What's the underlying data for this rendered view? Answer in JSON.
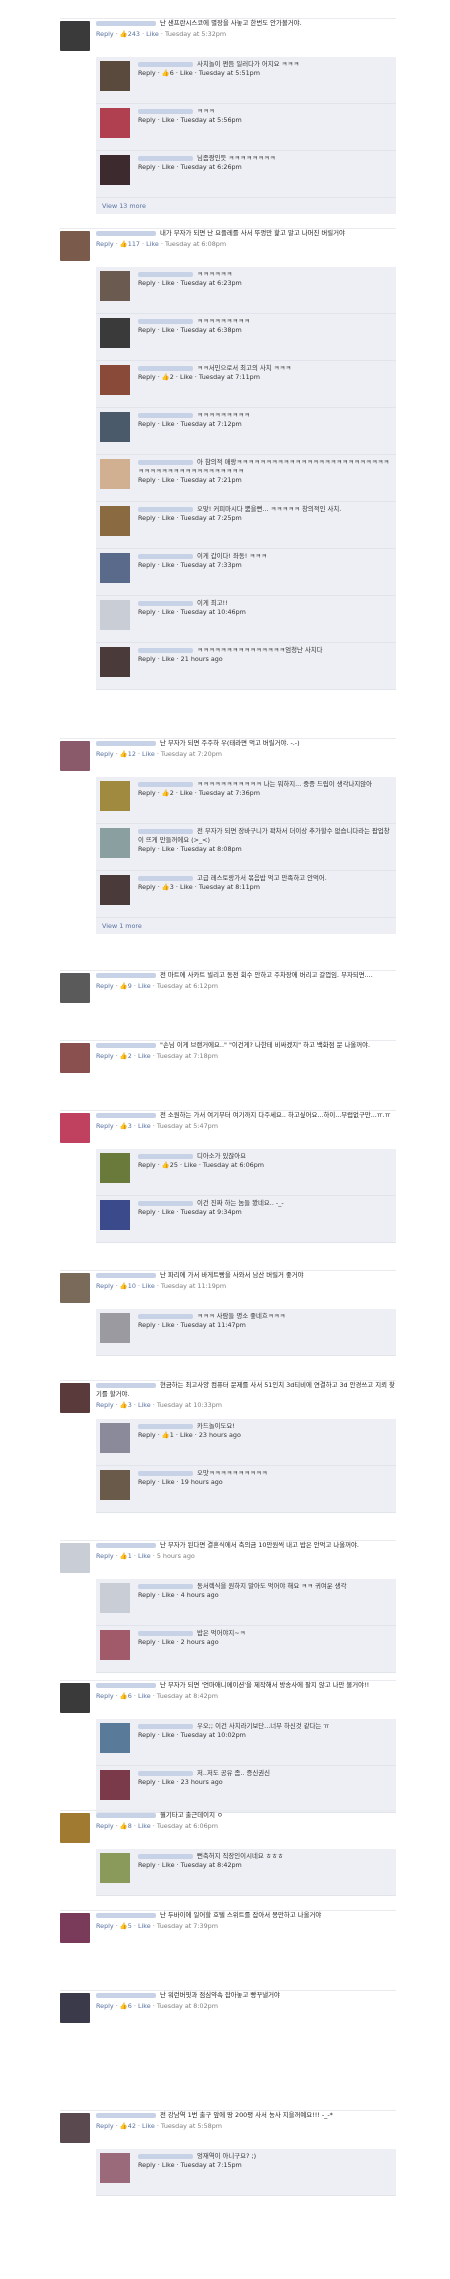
{
  "threads": [
    {
      "comment": {
        "text": "난 샌프란시스코에 별장을 사놓고 한번도 안가볼거야.",
        "likes": "243",
        "like": "Like",
        "reply": "Reply",
        "time": "Tuesday at 5:32pm",
        "color": "#3a3a3a"
      },
      "replies": [
        {
          "text": "사치놀이 쩐듬 일러다가 어지요 ㅋㅋㅋ",
          "likes": "6",
          "time": "Tuesday at 5:51pm",
          "color": "#5a4a3e"
        },
        {
          "text": "ㅋㅋㅋ",
          "likes": "",
          "time": "Tuesday at 5:56pm",
          "color": "#b04050"
        },
        {
          "text": "님좀짱인듯 ㅋㅋㅋㅋㅋㅋㅋㅋ",
          "likes": "",
          "time": "Tuesday at 6:26pm",
          "color": "#3c2a2e"
        }
      ],
      "view_more": "View 13 more"
    },
    {
      "comment": {
        "text": "내가 부자가 되면 난 요플레를 사서 뚜껑만 핥고 말고 나머진 버릴거야",
        "likes": "117",
        "like": "Like",
        "reply": "Reply",
        "time": "Tuesday at 6:08pm",
        "color": "#7a5a4a"
      },
      "replies": [
        {
          "text": "ㅋㅋㅋㅋㅋㅋ",
          "likes": "",
          "time": "Tuesday at 6:23pm",
          "color": "#6a5a50"
        },
        {
          "text": "ㅋㅋㅋㅋㅋㅋㅋㅋㅋ",
          "likes": "",
          "time": "Tuesday at 6:38pm",
          "color": "#3a3a3a"
        },
        {
          "text": "ㅋㅋ서민으로서 최고의 사치 ㅋㅋㅋ",
          "likes": "2",
          "time": "Tuesday at 7:11pm",
          "color": "#8a4a3a"
        },
        {
          "text": "ㅋㅋㅋㅋㅋㅋㅋㅋㅋ",
          "likes": "",
          "time": "Tuesday at 7:12pm",
          "color": "#4a5a6a"
        },
        {
          "text": "아 참의적 매랑ㅋㅋㅋㅋㅋㅋㅋㅋㅋㅋㅋㅋㅋㅋㅋㅋㅋㅋㅋㅋㅋㅋㅋㅋㅋㅋㅋㅋㅋㅋㅋㅋㅋㅋㅋㅋㅋㅋㅋㅋㅋㅋㅋㅋ",
          "likes": "",
          "time": "Tuesday at 7:21pm",
          "color": "#d0b090"
        },
        {
          "text": "오맞! 커피마시다 뿜을뻔... ㅋㅋㅋㅋㅋ 창의적인 사치.",
          "likes": "",
          "time": "Tuesday at 7:25pm",
          "color": "#8a6a40"
        },
        {
          "text": "이게 갑이다! 좌동! ㅋㅋㅋ",
          "likes": "",
          "time": "Tuesday at 7:33pm",
          "color": "#5a6a8a"
        },
        {
          "text": "이게 최고!!",
          "likes": "",
          "time": "Tuesday at 10:46pm",
          "color": "#c8cdd6"
        },
        {
          "text": "ㅋㅋㅋㅋㅋㅋㅋㅋㅋㅋㅋㅋㅋㅋㅋ엄청난 사치다",
          "likes": "",
          "time": "21 hours ago",
          "color": "#4a3a3a"
        }
      ]
    },
    {
      "comment": {
        "text": "난 부자가 되면 주주하 우(태라면 먹고 버릴거야. -.-)",
        "likes": "12",
        "like": "Like",
        "reply": "Reply",
        "time": "Tuesday at 7:20pm",
        "color": "#8a5a6a"
      },
      "replies": [
        {
          "text": "ㅋㅋㅋㅋㅋㅋㅋㅋㅋㅋㅋ 나는 뭐하지... 중증 드립이 생각나지않아",
          "likes": "2",
          "time": "Tuesday at 7:36pm",
          "color": "#a08a40"
        },
        {
          "text": "전 부자가 되면 장바구니가 꽉차서 더이상 추가할수 없습니다라는 팝업창이 뜨게 만들꺼에요 (>_<)",
          "likes": "",
          "time": "Tuesday at 8:08pm",
          "color": "#8aa0a0"
        },
        {
          "text": "고급 레스토랑가서 볶음밥 먹고 만족하고 안먹어.",
          "likes": "3",
          "time": "Tuesday at 8:11pm",
          "color": "#4a3a3a"
        }
      ],
      "view_more": "View 1 more"
    },
    {
      "comment": {
        "text": "전 마트에 사카트 빌리고 동전 회수 안하고 주차장에 버리고 갈껍임. 부자되면....",
        "likes": "9",
        "like": "Like",
        "reply": "Reply",
        "time": "Tuesday at 6:12pm",
        "color": "#5a5a5a"
      },
      "replies": []
    },
    {
      "comment": {
        "text": "\"손님 이게 브랜거에요..\" \"이건게? 나한테 비싸겠지\" 하고 백화점 문 나올꺼야.",
        "likes": "2",
        "like": "Like",
        "reply": "Reply",
        "time": "Tuesday at 7:18pm",
        "color": "#8a5050"
      },
      "replies": []
    },
    {
      "comment": {
        "text": "전 소원하는 가서 여기부터 여기까지 다주세요.. 하고싶어요...하이...부럽없구만...ㅠ.ㅠ",
        "likes": "3",
        "like": "Like",
        "reply": "Reply",
        "time": "Tuesday at 5:47pm",
        "color": "#c04060"
      },
      "replies": [
        {
          "text": "디아소가 있잖아요",
          "likes": "25",
          "time": "Tuesday at 6:06pm",
          "color": "#6a7a3a"
        },
        {
          "text": "이건 진짜 하는 놈들 봤네요.. -_-",
          "likes": "",
          "time": "Tuesday at 9:34pm",
          "color": "#3a4a8a"
        }
      ]
    },
    {
      "comment": {
        "text": "난 파리에 가서 바게트빵을 사와서 남산 버릴거 좋거야",
        "likes": "10",
        "like": "Like",
        "reply": "Reply",
        "time": "Tuesday at 11:19pm",
        "color": "#7a6a5a"
      },
      "replies": [
        {
          "text": "ㅋㅋㅋ 사람들 명소 좋네흐ㅋㅋㅋ",
          "likes": "",
          "time": "Tuesday at 11:47pm",
          "color": "#9a9aa0"
        }
      ]
    },
    {
      "comment": {
        "text": "현금하는 최고사양 컴퓨터 문제를 사서 51인치 3d티비에 연결하고 3d 안경쓰고 지뢰 찾기를 할거야.",
        "likes": "3",
        "like": "Like",
        "reply": "Reply",
        "time": "Tuesday at 10:33pm",
        "color": "#5a3a3a"
      },
      "replies": [
        {
          "text": "카드놀이도요!",
          "likes": "1",
          "time": "23 hours ago",
          "color": "#8a8a9a"
        },
        {
          "text": "오맛ㅋㅋㅋㅋㅋㅋㅋㅋㅋㅋ",
          "likes": "",
          "time": "19 hours ago",
          "color": "#6a5a4a"
        }
      ]
    },
    {
      "comment": {
        "text": "난 부자가 된다면 결혼식에서 축의금 10만원씩 내고 밥은 안먹고 나올꺼야.",
        "likes": "1",
        "like": "Like",
        "reply": "Reply",
        "time": "5 hours ago",
        "color": "#c8cdd6"
      },
      "replies": [
        {
          "text": "동서렉식을 원하지 말아도 먹어야 해요 ㅋㅋ 귀여운 생각",
          "likes": "",
          "time": "4 hours ago",
          "color": "#c8cdd6"
        },
        {
          "text": "밥은 먹어야지~ㅋ",
          "likes": "",
          "time": "2 hours ago",
          "color": "#a05a6a"
        }
      ]
    },
    {
      "comment": {
        "text": "난 부자가 되면 '언마애니메이션'을 제작해서 방송사에 팔지 않고 나만 볼거야!!",
        "likes": "6",
        "like": "Like",
        "reply": "Reply",
        "time": "Tuesday at 8:42pm",
        "color": "#3a3a3a"
      },
      "replies": [
        {
          "text": "우오;; 이건 사치라기보단...너무 하신것 같다는 ㅠ",
          "likes": "",
          "time": "Tuesday at 10:02pm",
          "color": "#5a7a9a"
        },
        {
          "text": "저..저도 공유 좀.. 증신권신",
          "likes": "",
          "time": "23 hours ago",
          "color": "#7a3a4a"
        }
      ]
    },
    {
      "comment": {
        "text": "뭘기타고 출근데이지 ㅇ",
        "likes": "8",
        "like": "Like",
        "reply": "Reply",
        "time": "Tuesday at 6:06pm",
        "color": "#a07a30"
      },
      "replies": [
        {
          "text": "뻔축허지 직장인이시네요 ㅎㅎㅎ",
          "likes": "",
          "time": "Tuesday at 8:42pm",
          "color": "#8a9a5a"
        }
      ]
    },
    {
      "comment": {
        "text": "난 두바이에 일어할 호텔 스위트를 잡아서 몽만하고 나올거야",
        "likes": "5",
        "like": "Like",
        "reply": "Reply",
        "time": "Tuesday at 7:39pm",
        "color": "#7a3a5a"
      },
      "replies": []
    },
    {
      "comment": {
        "text": "난 워런버핏과 점심약속 잡아놓고 빵꾸낼거야",
        "likes": "6",
        "like": "Like",
        "reply": "Reply",
        "time": "Tuesday at 8:02pm",
        "color": "#3a3a4a"
      },
      "replies": []
    },
    {
      "comment": {
        "text": "전 강남역 1번 출구 앞에 땅 200평 사서 농사 지을꺼예요!!! -_-*",
        "likes": "42",
        "like": "Like",
        "reply": "Reply",
        "time": "Tuesday at 5:58pm",
        "color": "#5a4a50"
      },
      "replies": [
        {
          "text": "엉재역이 아니구요? ;)",
          "likes": "",
          "time": "Tuesday at 7:15pm",
          "color": "#9a6a7a"
        }
      ]
    }
  ]
}
